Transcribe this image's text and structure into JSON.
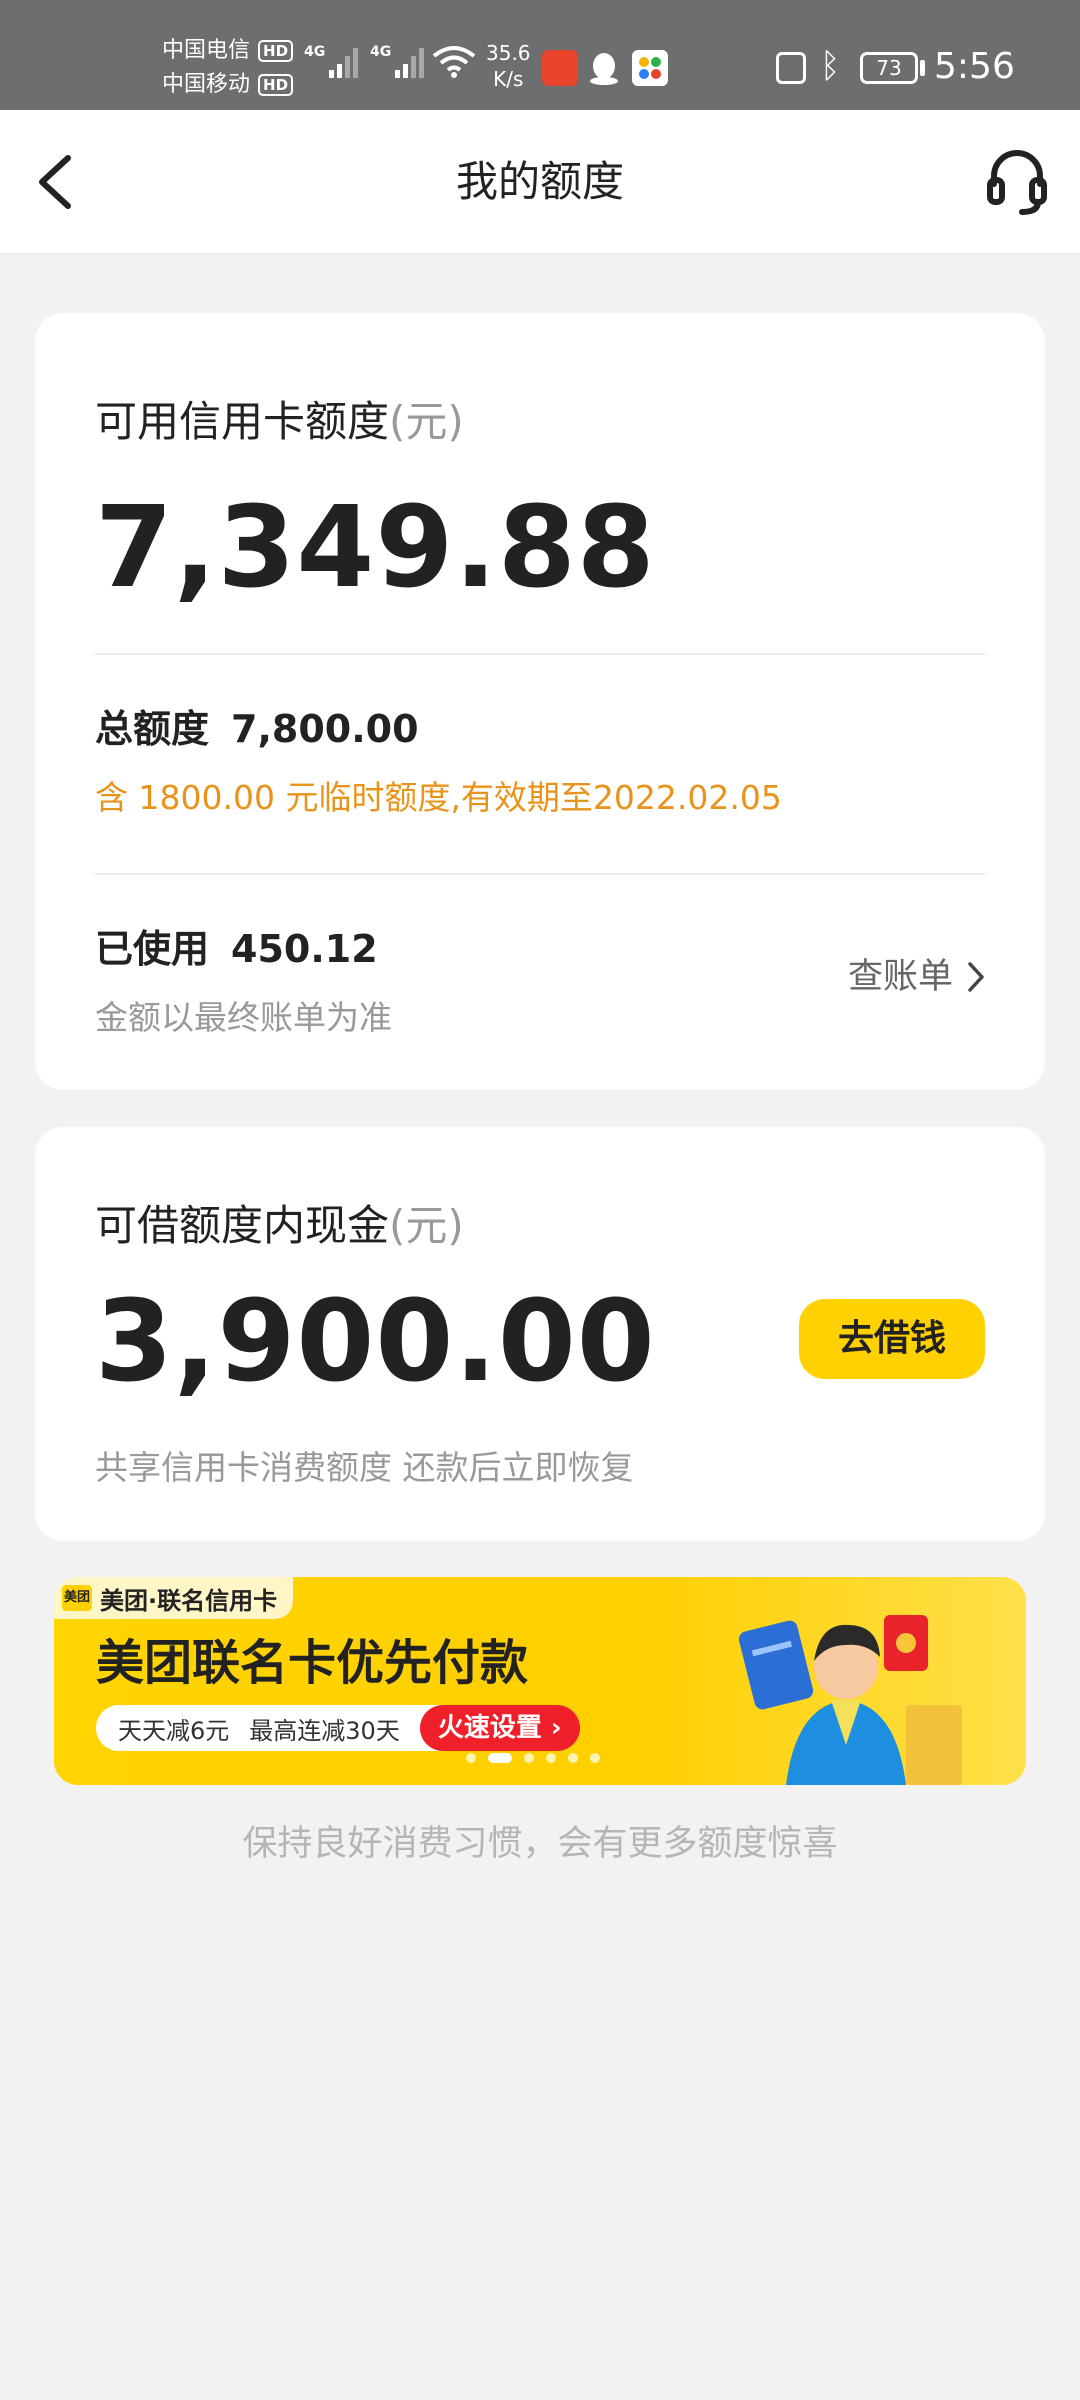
{
  "status_bar": {
    "carrier1": "中国电信",
    "carrier2": "中国移动",
    "hd": "HD",
    "net1": "4G",
    "net2": "4G",
    "speed_value": "35.6",
    "speed_unit": "K/s",
    "battery": "73",
    "time": "5:56"
  },
  "header": {
    "title": "我的额度"
  },
  "credit_card": {
    "available_label": "可用信用卡额度",
    "unit": "(元)",
    "available_value": "7,349.88",
    "total_label": "总额度",
    "total_value": "7,800.00",
    "temp_note": "含 1800.00 元临时额度,有效期至2022.02.05",
    "used_label": "已使用",
    "used_value": "450.12",
    "used_note": "金额以最终账单为准",
    "bill_link": "查账单"
  },
  "cash": {
    "label": "可借额度内现金",
    "unit": "(元)",
    "value": "3,900.00",
    "borrow_button": "去借钱",
    "note": "共享信用卡消费额度 还款后立即恢复"
  },
  "banner": {
    "logo_text": "美团",
    "tag": "美团·联名信用卡",
    "title": "美团联名卡优先付款",
    "pill_text1": "天天减6元",
    "pill_text2": "最高连减30天",
    "cta": "火速设置 ›",
    "dots_count": 6,
    "active_dot": 1
  },
  "footer": {
    "note": "保持良好消费习惯，会有更多额度惊喜"
  },
  "colors": {
    "accent_yellow": "#ffd100",
    "orange_note": "#e8941a",
    "status_bar": "#6e6e6e",
    "cta_red": "#f0202a"
  }
}
